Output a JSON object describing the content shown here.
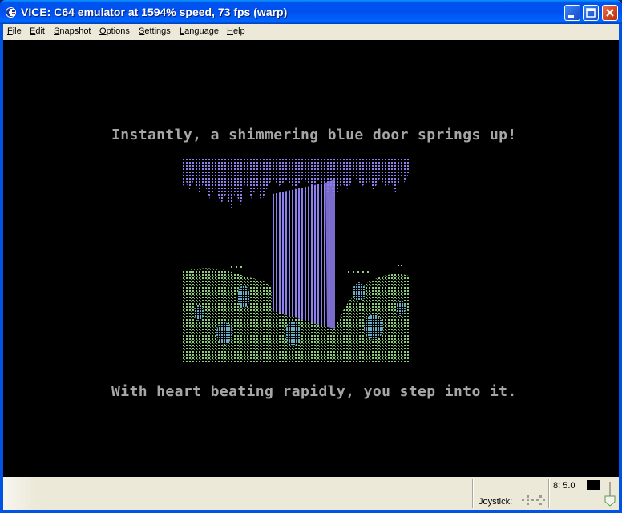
{
  "window": {
    "title": "VICE: C64 emulator at 1594% speed, 73 fps (warp)"
  },
  "menu": [
    {
      "label": "File",
      "accel": "F",
      "rest": "ile"
    },
    {
      "label": "Edit",
      "accel": "E",
      "rest": "dit"
    },
    {
      "label": "Snapshot",
      "accel": "S",
      "rest": "napshot"
    },
    {
      "label": "Options",
      "accel": "O",
      "rest": "ptions"
    },
    {
      "label": "Settings",
      "accel": "S",
      "rest": "ettings"
    },
    {
      "label": "Language",
      "accel": "L",
      "rest": "anguage"
    },
    {
      "label": "Help",
      "accel": "H",
      "rest": "elp"
    }
  ],
  "screen": {
    "line1": "Instantly, a shimmering blue door springs up!",
    "line2": "With heart beating rapidly, you step into it."
  },
  "status": {
    "joystick_label": "Joystick:",
    "drive_label": "8: 5.0"
  },
  "colors": {
    "c64_text": "#a6a6a6",
    "door": "#8f7ff0",
    "grass": "#8fd07a",
    "bush": "#6ab0c8"
  }
}
